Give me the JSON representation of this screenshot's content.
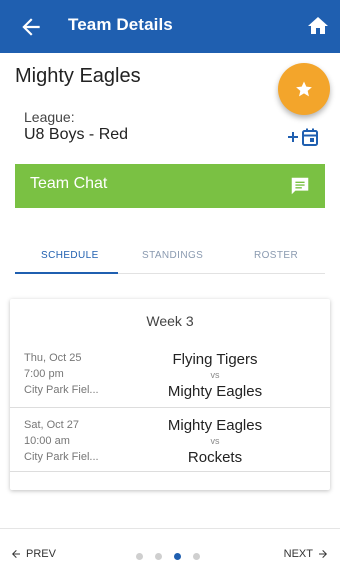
{
  "appbar": {
    "title": "Team Details"
  },
  "team": {
    "name": "Mighty Eagles",
    "league_label": "League:",
    "league_value": "U8 Boys - Red"
  },
  "chat": {
    "label": "Team Chat"
  },
  "tabs": [
    {
      "label": "SCHEDULE",
      "active": true
    },
    {
      "label": "STANDINGS",
      "active": false
    },
    {
      "label": "ROSTER",
      "active": false
    }
  ],
  "schedule": {
    "week": "Week 3",
    "games": [
      {
        "date": "Thu, Oct 25",
        "time": "7:00 pm",
        "location": "City Park Fiel...",
        "home": "Flying Tigers",
        "vs": "vs",
        "away": "Mighty Eagles"
      },
      {
        "date": "Sat, Oct 27",
        "time": "10:00 am",
        "location": "City Park Fiel...",
        "home": "Mighty Eagles",
        "vs": "vs",
        "away": "Rockets"
      }
    ]
  },
  "pager": {
    "prev_label": "PREV",
    "next_label": "NEXT",
    "total_pages": 4,
    "current_page": 3
  },
  "colors": {
    "primary": "#1f5fb0",
    "accent": "#f3a52b",
    "chat": "#7ac143"
  },
  "icons": {
    "back": "arrow-left-icon",
    "home": "home-icon",
    "fab": "star-icon",
    "add_calendar": "add-calendar-icon",
    "chat": "chat-bubble-icon"
  }
}
